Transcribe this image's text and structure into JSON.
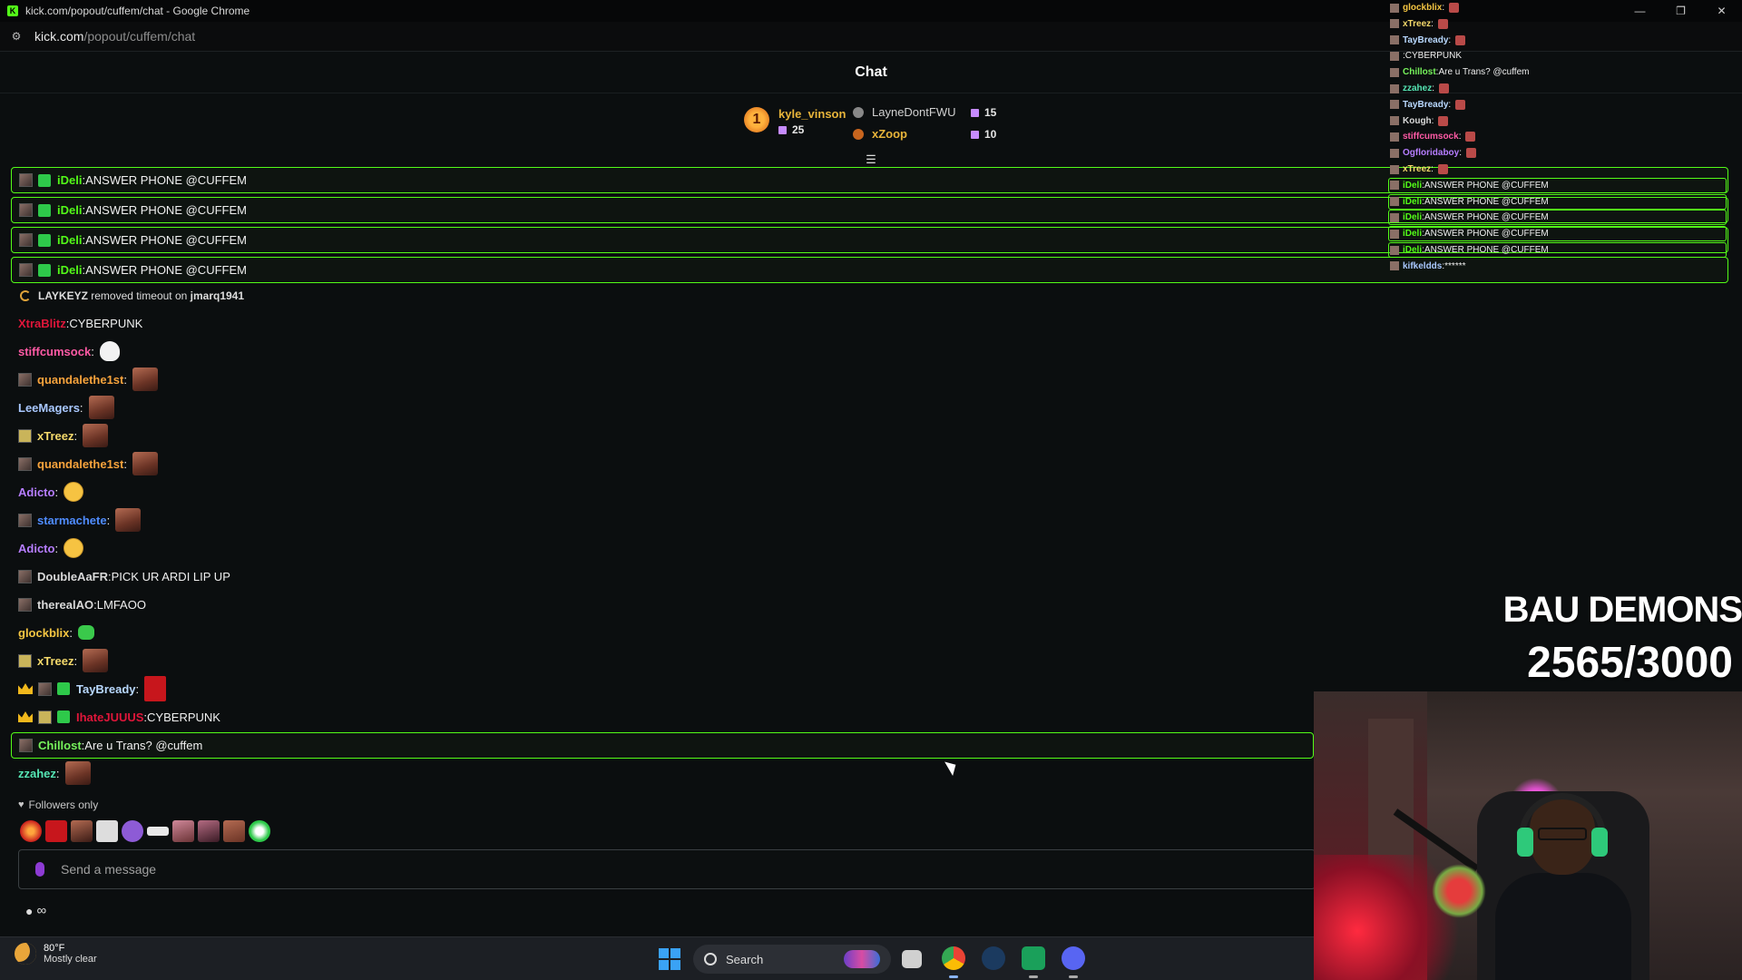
{
  "window": {
    "title": "kick.com/popout/cuffem/chat - Google Chrome",
    "minimize": "—",
    "restore": "❐",
    "close": "✕"
  },
  "address": {
    "host": "kick.com",
    "path": "/popout/cuffem/chat"
  },
  "chat": {
    "title": "Chat"
  },
  "leaderboard": {
    "first": {
      "name": "kyle_vinson",
      "count": "25",
      "rank": "1"
    },
    "second": {
      "name": "LayneDontFWU",
      "count": "15"
    },
    "third": {
      "name": "xZoop",
      "count": "10"
    }
  },
  "pinned": [
    {
      "user": "iDeli",
      "text": "ANSWER PHONE @CUFFEM"
    },
    {
      "user": "iDeli",
      "text": "ANSWER PHONE @CUFFEM"
    },
    {
      "user": "iDeli",
      "text": "ANSWER PHONE @CUFFEM"
    },
    {
      "user": "iDeli",
      "text": "ANSWER PHONE @CUFFEM"
    }
  ],
  "system": {
    "actor": "LAYKEYZ",
    "action": "removed timeout on",
    "target": "jmarq1941"
  },
  "messages": [
    {
      "user": "XtraBlitz",
      "text": "CYBERPUNK",
      "color": "#e0163a"
    },
    {
      "user": "stiffcumsock",
      "text": "",
      "color": "#ff5aa5"
    },
    {
      "user": "quandalethe1st",
      "text": "",
      "color": "#f7a33c"
    },
    {
      "user": "LeeMagers",
      "text": "",
      "color": "#a9c8ff"
    },
    {
      "user": "xTreez",
      "text": "",
      "color": "#f4d96b"
    },
    {
      "user": "quandalethe1st",
      "text": "",
      "color": "#f7a33c"
    },
    {
      "user": "Adicto",
      "text": "",
      "color": "#b67dff"
    },
    {
      "user": "starmachete",
      "text": "",
      "color": "#4f8cff"
    },
    {
      "user": "Adicto",
      "text": "",
      "color": "#b67dff"
    },
    {
      "user": "DoubleAaFR",
      "text": "PICK UR ARDI LIP UP",
      "color": "#d9d9d9"
    },
    {
      "user": "therealAO",
      "text": "LMFAOO",
      "color": "#d9d9d9"
    },
    {
      "user": "glockblix",
      "text": "",
      "color": "#f4c542"
    },
    {
      "user": "xTreez",
      "text": "",
      "color": "#f4d96b"
    },
    {
      "user": "TayBready",
      "text": "",
      "color": "#b9d9ff"
    },
    {
      "user": "IhateJUUUS",
      "text": "CYBERPUNK",
      "color": "#e0163a"
    },
    {
      "user": "Chillost",
      "text": "Are u Trans? @cuffem",
      "color": "#76f25b"
    },
    {
      "user": "zzahez",
      "text": "",
      "color": "#55e6b4"
    }
  ],
  "footer": {
    "followers_only": "Followers only",
    "input_placeholder": "Send a message",
    "infinity": "∞"
  },
  "overlay": {
    "lines": [
      {
        "user": "glockblix",
        "text": "",
        "color": "#f4c542"
      },
      {
        "user": "xTreez",
        "text": "",
        "color": "#f4d96b"
      },
      {
        "user": "TayBready",
        "text": "",
        "color": "#b9d9ff"
      },
      {
        "user": "",
        "text": "CYBERPUNK",
        "color": "#e0163a"
      },
      {
        "user": "Chillost",
        "text": "Are u Trans? @cuffem",
        "color": "#76f25b"
      },
      {
        "user": "zzahez",
        "text": "",
        "color": "#55e6b4"
      },
      {
        "user": "TayBready",
        "text": "",
        "color": "#b9d9ff"
      },
      {
        "user": "Kough",
        "text": "",
        "color": "#d9d9d9"
      },
      {
        "user": "stiffcumsock",
        "text": "",
        "color": "#ff5aa5"
      },
      {
        "user": "Ogfloridaboy",
        "text": "",
        "color": "#b67dff"
      },
      {
        "user": "xTreez",
        "text": "",
        "color": "#f4d96b"
      },
      {
        "user": "iDeli",
        "text": "ANSWER PHONE @CUFFEM",
        "color": "#53fc18"
      },
      {
        "user": "iDeli",
        "text": "ANSWER PHONE @CUFFEM",
        "color": "#53fc18"
      },
      {
        "user": "iDeli",
        "text": "ANSWER PHONE @CUFFEM",
        "color": "#53fc18"
      },
      {
        "user": "iDeli",
        "text": "ANSWER PHONE @CUFFEM",
        "color": "#53fc18"
      },
      {
        "user": "iDeli",
        "text": "ANSWER PHONE @CUFFEM",
        "color": "#53fc18"
      },
      {
        "user": "kifkeldds",
        "text": "******",
        "color": "#a9c8ff"
      }
    ]
  },
  "goal": {
    "title": "BAU DEMONS",
    "count": "2565/3000"
  },
  "taskbar": {
    "temp": "80°F",
    "condition": "Mostly clear",
    "search_label": "Search"
  },
  "colors": {
    "kick_green": "#53fc18",
    "background": "#0b0e0f"
  }
}
